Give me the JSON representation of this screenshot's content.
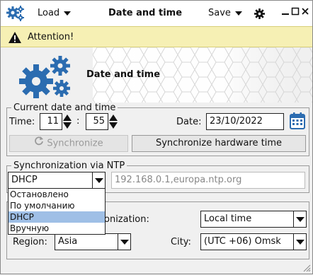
{
  "toolbar": {
    "load_label": "Load",
    "title": "Date and time",
    "save_label": "Save"
  },
  "attention": {
    "text": "Attention!"
  },
  "banner": {
    "heading": "Date and time"
  },
  "current": {
    "legend": "Current date and time",
    "time_label": "Time:",
    "hour": "11",
    "separator": ":",
    "minute": "55",
    "date_label": "Date:",
    "date": "23/10/2022",
    "sync_label": "Synchronize",
    "sync_hw_label": "Synchronize hardware time"
  },
  "ntp": {
    "legend": "Synchronization via NTP",
    "mode": "DHCP",
    "servers": "192.168.0.1,europa.ntp.org",
    "options": [
      "Остановлено",
      "По умолчанию",
      "DHCP",
      "Вручную"
    ],
    "selected_index": 2
  },
  "tz": {
    "sync_label_partial": "onization:",
    "sync_value": "Local time",
    "region_label": "Region:",
    "region": "Asia",
    "city_label": "City:",
    "city": "(UTC +06) Omsk"
  },
  "colors": {
    "accent": "#2b6cb0",
    "attention_bg": "#f6f0b4",
    "selected_option": "#9fbfe6"
  }
}
